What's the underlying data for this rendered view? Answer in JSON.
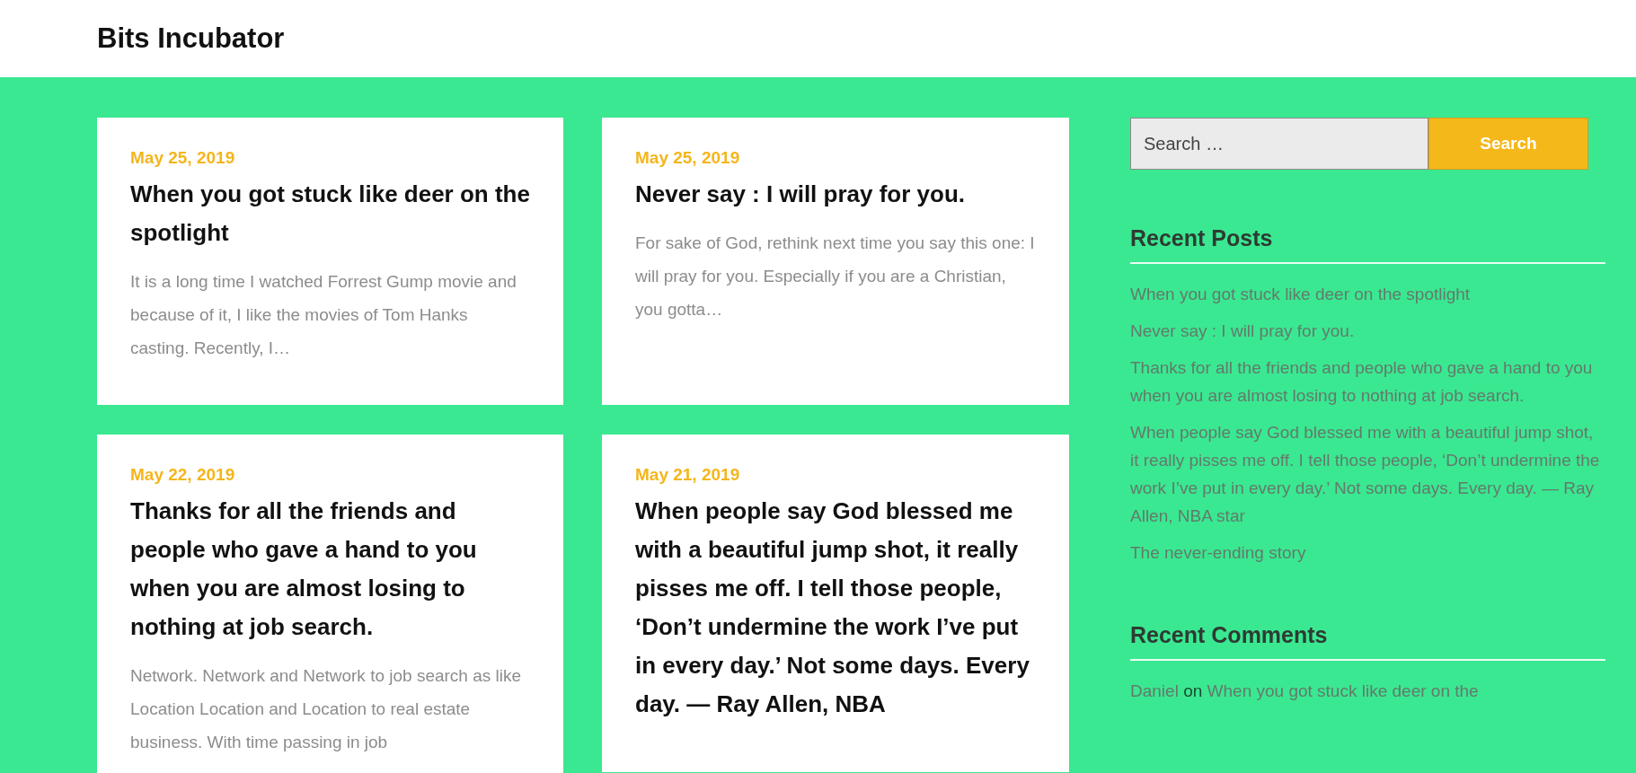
{
  "site_title": "Bits Incubator",
  "posts": [
    {
      "date": "May 25, 2019",
      "title": "When you got stuck like deer on the spotlight",
      "excerpt": "It is a long time I watched Forrest Gump movie and because of it, I like the movies of Tom Hanks casting.  Recently, I…"
    },
    {
      "date": "May 25, 2019",
      "title": "Never say : I will pray for you.",
      "excerpt": "For sake of God, rethink next time you say this one: I will pray for you. Especially if you are a Christian, you gotta…"
    },
    {
      "date": "May 22, 2019",
      "title": "Thanks for all the friends and people who gave a hand to you when you are almost losing to nothing at job search.",
      "excerpt": "Network. Network and Network to job search as like Location Location and Location to real estate business.  With time passing in job"
    },
    {
      "date": "May 21, 2019",
      "title": "When people say God blessed me with a beautiful jump shot, it really pisses me off. I tell those people, ‘Don’t undermine the work I’ve put in every day.’ Not some days. Every day. — Ray Allen, NBA"
    }
  ],
  "search": {
    "placeholder": "Search …",
    "button": "Search"
  },
  "recent_posts": {
    "title": "Recent Posts",
    "items": [
      "When you got stuck like deer on the spotlight",
      "Never say : I will pray for you.",
      "Thanks for all the friends and people who gave a hand to you when you are almost losing to nothing at job search.",
      "When people say God blessed me with a beautiful jump shot, it really pisses me off. I tell those people, ‘Don’t undermine the work I’ve put in every day.’ Not some days. Every day. — Ray Allen, NBA star",
      "The never-ending story"
    ]
  },
  "recent_comments": {
    "title": "Recent Comments",
    "items": [
      {
        "author": "Daniel",
        "connector": "on",
        "post": "When you got stuck like deer on the"
      }
    ]
  }
}
